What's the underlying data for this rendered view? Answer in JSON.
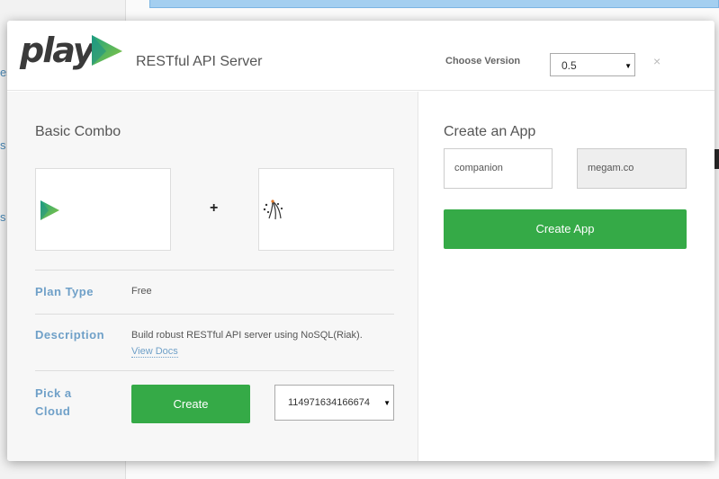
{
  "background": {
    "sidebar_items": [
      "es",
      "s",
      "s"
    ]
  },
  "header": {
    "logo_text": "play",
    "title": "RESTful API Server",
    "version_label": "Choose Version",
    "version_value": "0.5",
    "close_label": "×"
  },
  "left": {
    "section_title": "Basic Combo",
    "plus": "+",
    "plan_type_label": "Plan Type",
    "plan_type_value": "Free",
    "description_label": "Description",
    "description_value": "Build robust RESTful API server using NoSQL(Riak).",
    "view_docs": "View Docs",
    "pick_cloud_label": "Pick a Cloud",
    "create_button": "Create",
    "cloud_value": "114971634166674"
  },
  "right": {
    "section_title": "Create an App",
    "app_name_value": "companion",
    "domain_value": "megam.co",
    "create_app_button": "Create App"
  },
  "colors": {
    "accent_green": "#35aa47",
    "label_blue": "#6fa0c8"
  }
}
